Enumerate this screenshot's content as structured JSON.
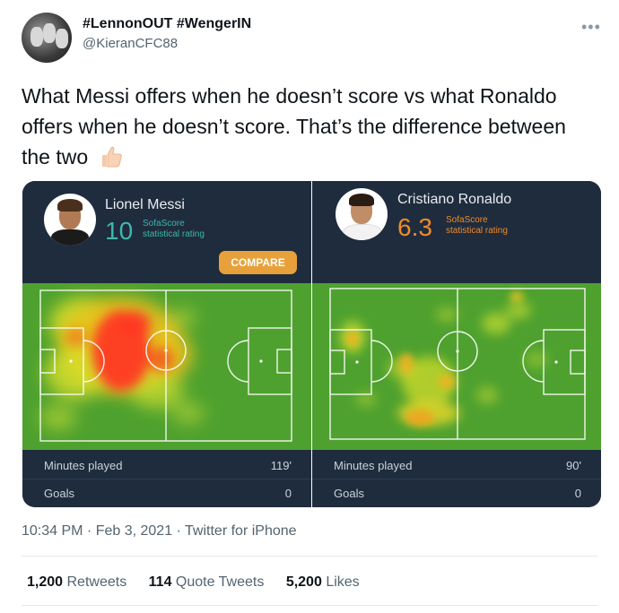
{
  "tweet": {
    "display_name": "#LennonOUT #WengerIN",
    "handle": "@KieranCFC88",
    "more_icon": "more-horizontal-icon",
    "text": "What Messi offers when he doesn’t score vs what Ronaldo offers when he doesn’t score. That’s the difference between the two",
    "emoji": "thumbs-up-icon",
    "timestamp": "10:34 PM · Feb 3, 2021 · ",
    "source": "Twitter for iPhone",
    "retweets_count": "1,200",
    "retweets_label": "Retweets",
    "quotes_count": "114",
    "quotes_label": "Quote Tweets",
    "likes_count": "5,200",
    "likes_label": "Likes"
  },
  "cards": {
    "messi": {
      "name": "Lionel Messi",
      "rating": "10",
      "rating_source_line1": "SofaScore",
      "rating_source_line2": "statistical rating",
      "rating_color": "#3fb7ad",
      "compare_label": "COMPARE",
      "minutes_label": "Minutes played",
      "minutes_value": "119'",
      "goals_label": "Goals",
      "goals_value": "0"
    },
    "ronaldo": {
      "name": "Cristiano Ronaldo",
      "rating": "6.3",
      "rating_source_line1": "SofaScore",
      "rating_source_line2": "statistical rating",
      "rating_color": "#f08a2a",
      "minutes_label": "Minutes played",
      "minutes_value": "90'",
      "goals_label": "Goals",
      "goals_value": "0"
    }
  },
  "colors": {
    "pitch": "#4ea12f",
    "card_bg": "#1f2c3d",
    "compare_button": "#e8a13a"
  }
}
